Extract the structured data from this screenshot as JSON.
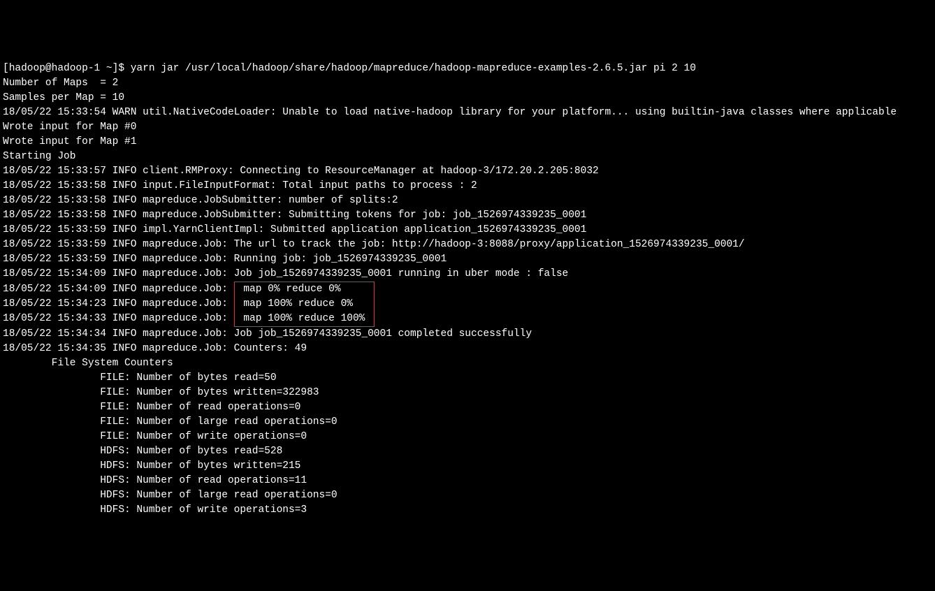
{
  "prompt": "[hadoop@hadoop-1 ~]$ yarn jar /usr/local/hadoop/share/hadoop/mapreduce/hadoop-mapreduce-examples-2.6.5.jar pi 2 10",
  "lines_before": [
    "Number of Maps  = 2",
    "Samples per Map = 10",
    "18/05/22 15:33:54 WARN util.NativeCodeLoader: Unable to load native-hadoop library for your platform... using builtin-java classes where applicable",
    "Wrote input for Map #0",
    "Wrote input for Map #1",
    "Starting Job",
    "18/05/22 15:33:57 INFO client.RMProxy: Connecting to ResourceManager at hadoop-3/172.20.2.205:8032",
    "18/05/22 15:33:58 INFO input.FileInputFormat: Total input paths to process : 2",
    "18/05/22 15:33:58 INFO mapreduce.JobSubmitter: number of splits:2",
    "18/05/22 15:33:58 INFO mapreduce.JobSubmitter: Submitting tokens for job: job_1526974339235_0001",
    "18/05/22 15:33:59 INFO impl.YarnClientImpl: Submitted application application_1526974339235_0001",
    "18/05/22 15:33:59 INFO mapreduce.Job: The url to track the job: http://hadoop-3:8088/proxy/application_1526974339235_0001/",
    "18/05/22 15:33:59 INFO mapreduce.Job: Running job: job_1526974339235_0001",
    "18/05/22 15:34:09 INFO mapreduce.Job: Job job_1526974339235_0001 running in uber mode : false"
  ],
  "highlight": {
    "prefixes": [
      "18/05/22 15:34:09 INFO mapreduce.Job: ",
      "18/05/22 15:34:23 INFO mapreduce.Job: ",
      "18/05/22 15:34:33 INFO mapreduce.Job: "
    ],
    "contents": [
      " map 0% reduce 0%     ",
      " map 100% reduce 0%   ",
      " map 100% reduce 100% "
    ]
  },
  "lines_after": [
    "18/05/22 15:34:34 INFO mapreduce.Job: Job job_1526974339235_0001 completed successfully",
    "18/05/22 15:34:35 INFO mapreduce.Job: Counters: 49",
    "        File System Counters",
    "                FILE: Number of bytes read=50",
    "                FILE: Number of bytes written=322983",
    "                FILE: Number of read operations=0",
    "                FILE: Number of large read operations=0",
    "                FILE: Number of write operations=0",
    "                HDFS: Number of bytes read=528",
    "                HDFS: Number of bytes written=215",
    "                HDFS: Number of read operations=11",
    "                HDFS: Number of large read operations=0",
    "                HDFS: Number of write operations=3"
  ]
}
